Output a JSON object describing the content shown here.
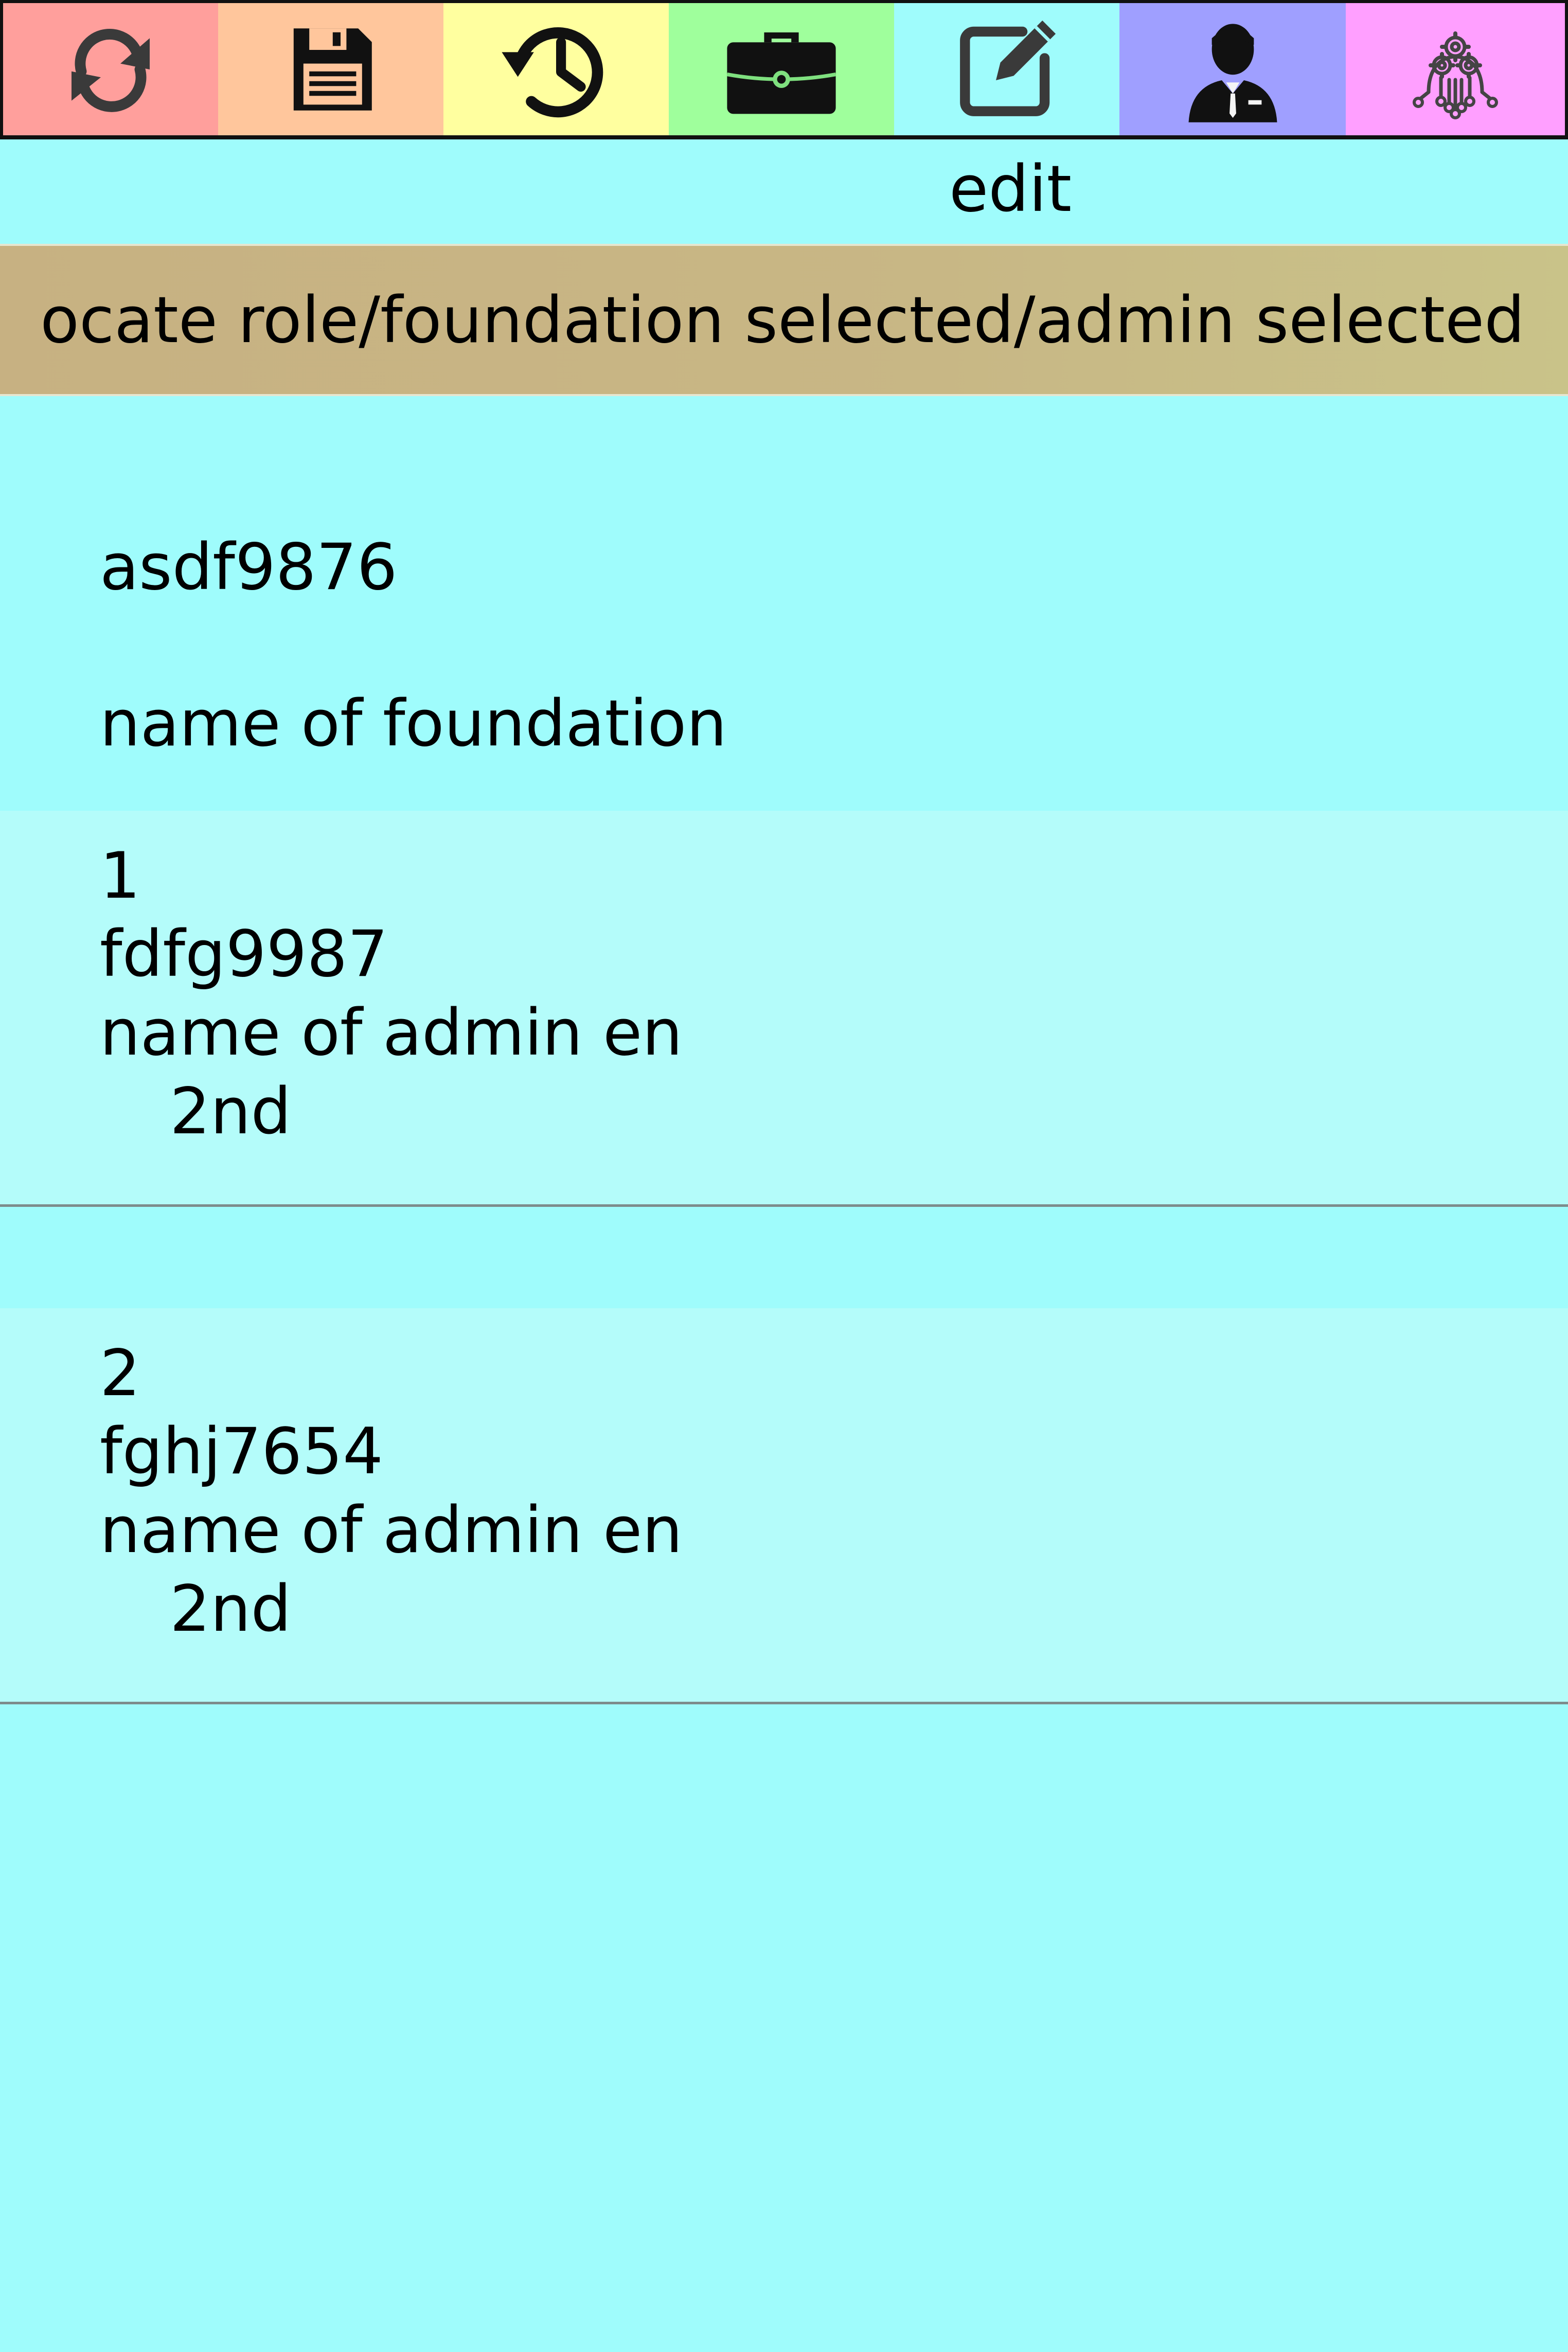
{
  "toolbar": {
    "items": [
      {
        "icon": "refresh-icon",
        "color": "#ff9f9c"
      },
      {
        "icon": "save-icon",
        "color": "#ffc69c"
      },
      {
        "icon": "history-icon",
        "color": "#ffff9f"
      },
      {
        "icon": "briefcase-icon",
        "color": "#9fff9c"
      },
      {
        "icon": "edit-icon",
        "color": "#9ffcfc"
      },
      {
        "icon": "admin-user-icon",
        "color": "#9f9fff"
      },
      {
        "icon": "network-settings-icon",
        "color": "#ff9fff"
      }
    ]
  },
  "page": {
    "title": "edit",
    "background": "#9ffcfc"
  },
  "breadcrumb": {
    "text": "ocate role/foundation selected/admin selected",
    "color": "#c8b785"
  },
  "foundation": {
    "code": "asdf9876",
    "name": "name of foundation"
  },
  "admins": [
    {
      "index": "1",
      "code": "fdfg9987",
      "name": "name of admin en",
      "name_2": "2nd"
    },
    {
      "index": "2",
      "code": "fghj7654",
      "name": "name of admin en",
      "name_2": "2nd"
    }
  ]
}
